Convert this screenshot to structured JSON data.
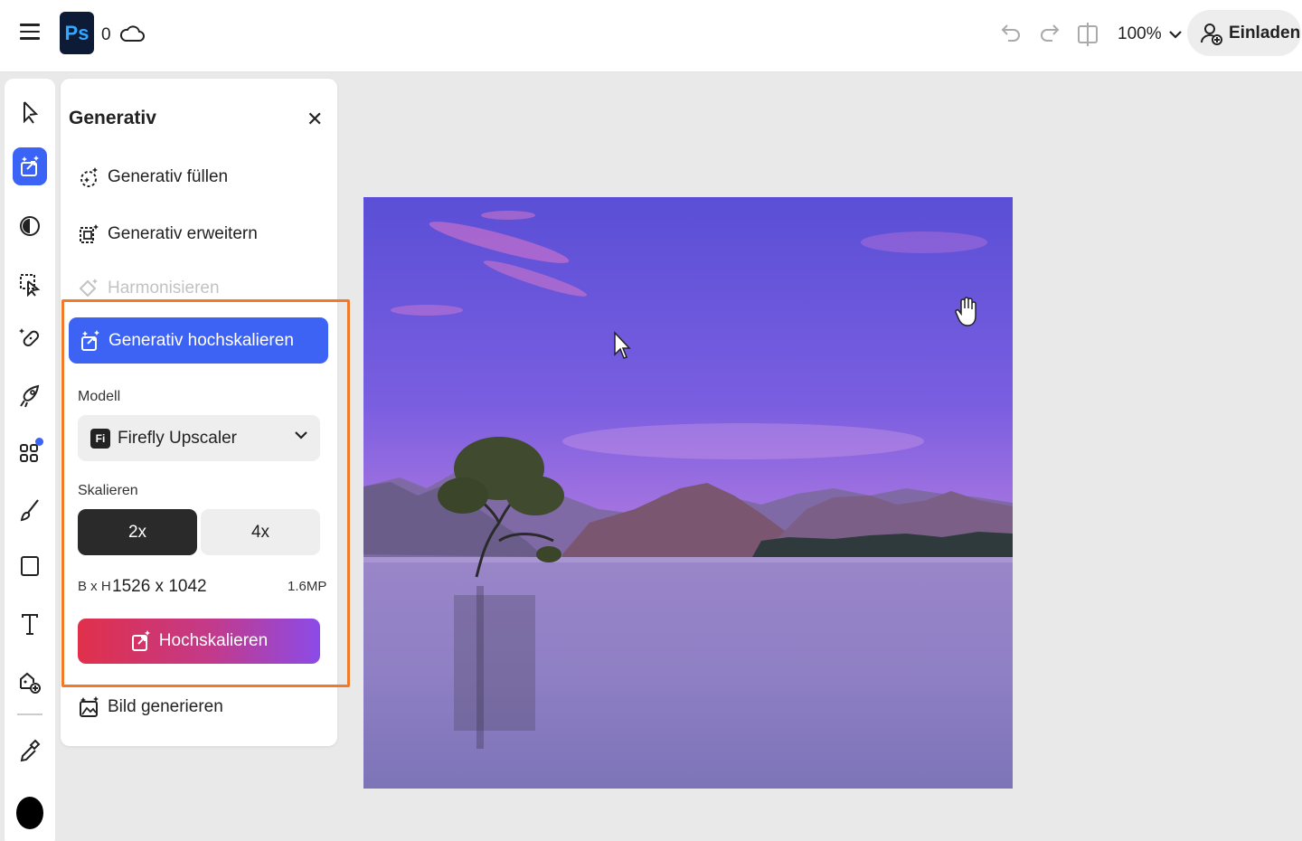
{
  "topbar": {
    "doc_count": "0",
    "zoom": "100%",
    "invite_label": "Einladen",
    "logo_text": "Ps"
  },
  "panel": {
    "title": "Generativ",
    "items": [
      {
        "label": "Generativ füllen",
        "icon": "generative-fill-icon"
      },
      {
        "label": "Generativ erweitern",
        "icon": "generative-expand-icon"
      },
      {
        "label": "Harmonisieren",
        "icon": "harmonize-icon",
        "disabled": true
      },
      {
        "label": "Generativ hochskalieren",
        "icon": "generative-upscale-icon",
        "active": true
      },
      {
        "label": "Bild generieren",
        "icon": "generate-image-icon"
      }
    ],
    "model_label": "Modell",
    "model_badge": "Fi",
    "model_value": "Firefly Upscaler",
    "scale_label": "Skalieren",
    "scale_options": [
      "2x",
      "4x"
    ],
    "scale_selected": "2x",
    "dims_label": "B x H",
    "dims_value": "1526 x 1042",
    "megapixels": "1.6MP",
    "upscale_button": "Hochskalieren"
  },
  "colors": {
    "accent": "#3d63f5",
    "highlight": "#f07a2a",
    "foreground_color": "#000000"
  }
}
